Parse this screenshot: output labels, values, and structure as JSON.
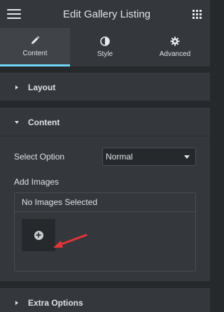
{
  "header": {
    "title": "Edit Gallery Listing",
    "menu_icon": "hamburger-icon",
    "apps_icon": "grid-icon"
  },
  "tabs": [
    {
      "label": "Content",
      "icon": "pencil-icon",
      "active": true
    },
    {
      "label": "Style",
      "icon": "contrast-icon",
      "active": false
    },
    {
      "label": "Advanced",
      "icon": "gear-icon",
      "active": false
    }
  ],
  "sections": {
    "layout": {
      "label": "Layout",
      "expanded": false
    },
    "content": {
      "label": "Content",
      "expanded": true
    },
    "extra": {
      "label": "Extra Options",
      "expanded": false
    }
  },
  "content": {
    "select_label": "Select Option",
    "select_value": "Normal",
    "images_label": "Add Images",
    "images_status": "No Images Selected"
  },
  "colors": {
    "accent": "#71d7f7",
    "annotation_arrow": "#e3343a"
  }
}
